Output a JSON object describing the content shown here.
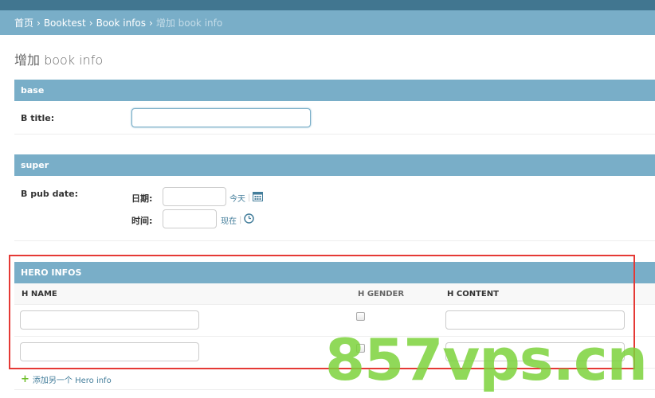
{
  "breadcrumbs": {
    "home": "首页",
    "app": "Booktest",
    "model": "Book infos",
    "current": "增加 book info",
    "separator": "›"
  },
  "page": {
    "title": "增加 book info"
  },
  "fieldsets": {
    "base": {
      "title": "base",
      "b_title_label": "B title:",
      "b_title_value": ""
    },
    "super": {
      "title": "super",
      "b_pub_date_label": "B pub date:",
      "date_label": "日期:",
      "date_value": "",
      "today_link": "今天",
      "time_label": "时间:",
      "time_value": "",
      "now_link": "现在"
    }
  },
  "inline": {
    "title": "HERO INFOS",
    "columns": [
      "H NAME",
      "H GENDER",
      "H CONTENT"
    ],
    "rows": [
      {
        "h_name": "",
        "h_gender": false,
        "h_content": ""
      },
      {
        "h_name": "",
        "h_gender": false,
        "h_content": ""
      }
    ],
    "add_link": "添加另一个 Hero info"
  },
  "watermark": "857vps.cn",
  "colors": {
    "header_dark": "#417690",
    "header_light": "#79aec8",
    "link": "#447e9b",
    "highlight_border": "#e53935",
    "watermark": "#7cd23c"
  },
  "icons": {
    "calendar": "calendar-icon",
    "clock": "clock-icon",
    "add": "plus-icon"
  }
}
